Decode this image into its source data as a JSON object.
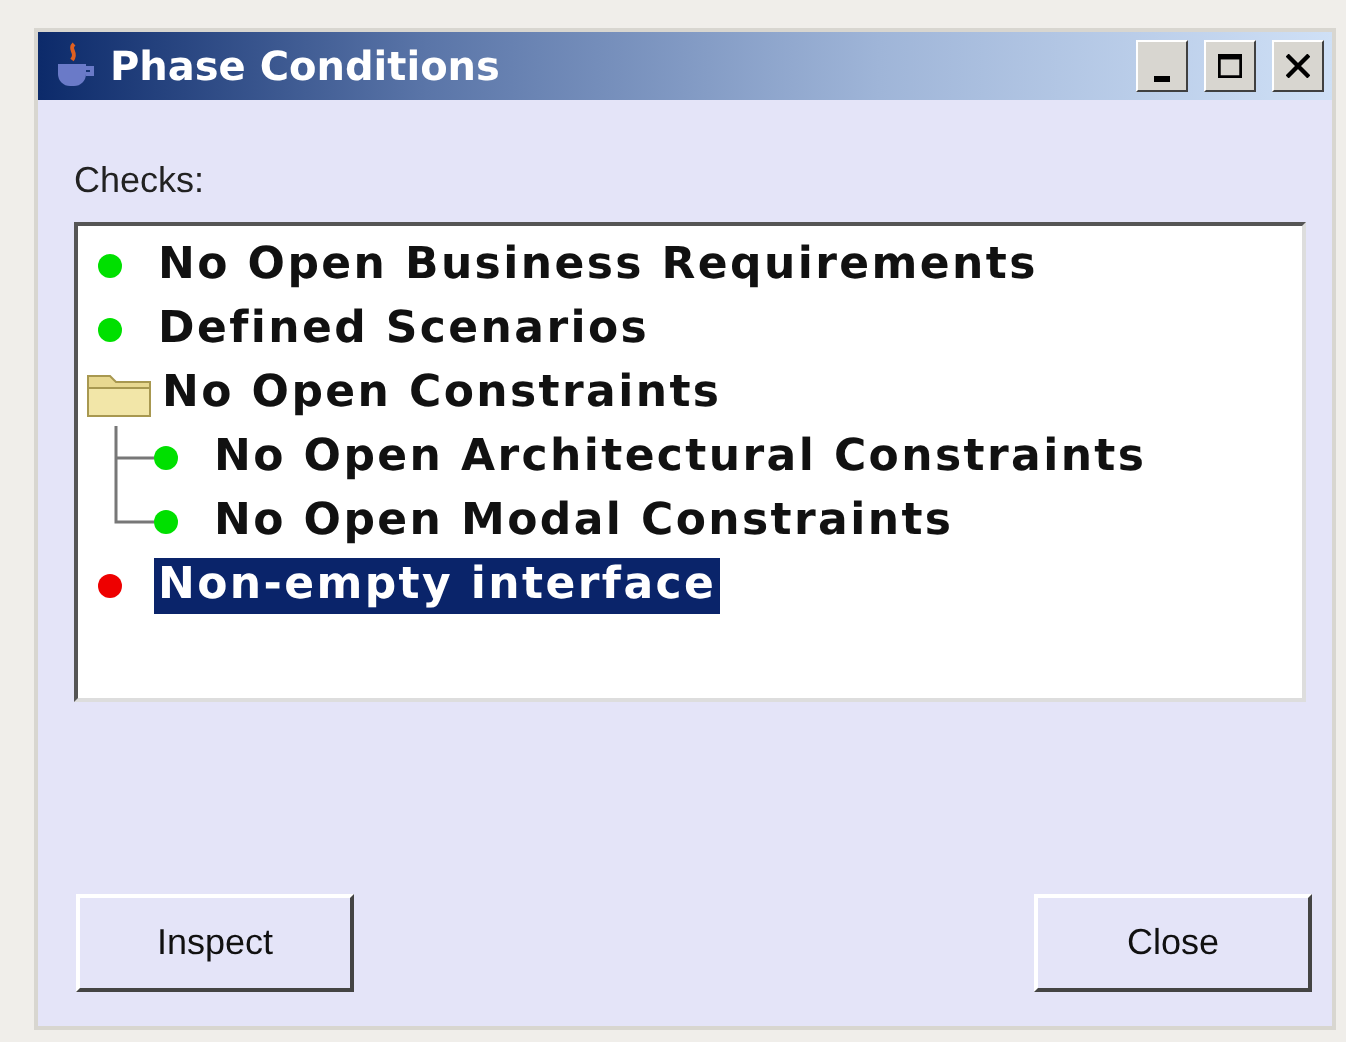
{
  "window": {
    "title": "Phase Conditions"
  },
  "label": "Checks:",
  "tree": [
    {
      "kind": "dot",
      "label": "No Open Business Requirements",
      "color": "#00e000",
      "selected": false
    },
    {
      "kind": "dot",
      "label": "Defined Scenarios",
      "color": "#00e000",
      "selected": false
    },
    {
      "kind": "folder",
      "label": "No Open Constraints",
      "selected": false,
      "children": [
        {
          "kind": "dot",
          "label": "No Open Architectural Constraints",
          "color": "#00e000",
          "selected": false
        },
        {
          "kind": "dot",
          "label": "No Open Modal Constraints",
          "color": "#00e000",
          "selected": false
        }
      ]
    },
    {
      "kind": "dot",
      "label": "Non-empty interface",
      "color": "#ee0000",
      "selected": true
    }
  ],
  "buttons": [
    "Inspect",
    "Close"
  ]
}
